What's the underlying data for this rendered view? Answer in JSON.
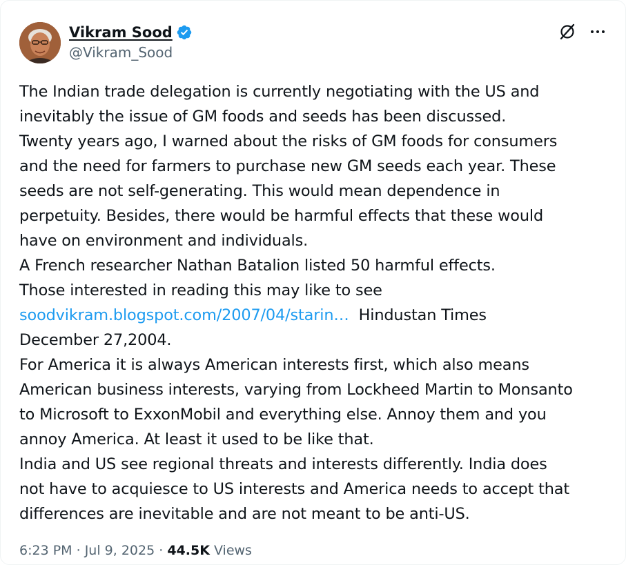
{
  "author": {
    "name": "Vikram Sood",
    "handle": "@Vikram_Sood",
    "verified": true,
    "verified_color": "#1d9bf0"
  },
  "icons": {
    "grok": "grok-icon",
    "more": "more-icon"
  },
  "tweet": {
    "lines": [
      "The Indian trade delegation is currently negotiating with the US and",
      "inevitably the issue of GM foods and seeds has been discussed.",
      "Twenty years ago, I warned about the risks of GM foods for consumers",
      "and the need for farmers to purchase new GM seeds each year.  These",
      "seeds are not self-generating.  This would mean dependence in",
      "perpetuity.  Besides, there would be harmful effects that these would",
      "have on environment and individuals.",
      "A French researcher Nathan Batalion listed 50 harmful effects.",
      "Those interested in reading this may like to see"
    ],
    "link_text": "soodvikram.blogspot.com/2007/04/starin…",
    "link_after": "  Hindustan Times",
    "lines_after_link": [
      "December 27,2004.",
      "For America it is always American interests first, which also means",
      "American business interests, varying from Lockheed Martin to Monsanto",
      "to Microsoft to ExxonMobil and everything else. Annoy them and you",
      "annoy America. At least it used to be like that.",
      "India and US see regional threats and interests differently.  India does",
      "not have to acquiesce to US interests and America needs to accept that",
      "differences are inevitable and are not meant to be anti-US."
    ]
  },
  "meta": {
    "time": "6:23 PM",
    "separator": " · ",
    "date": "Jul 9, 2025",
    "separator2": " · ",
    "views_count": "44.5K",
    "views_label": " Views"
  },
  "colors": {
    "text": "#0f1419",
    "secondary": "#536471",
    "link": "#1d9bf0"
  }
}
